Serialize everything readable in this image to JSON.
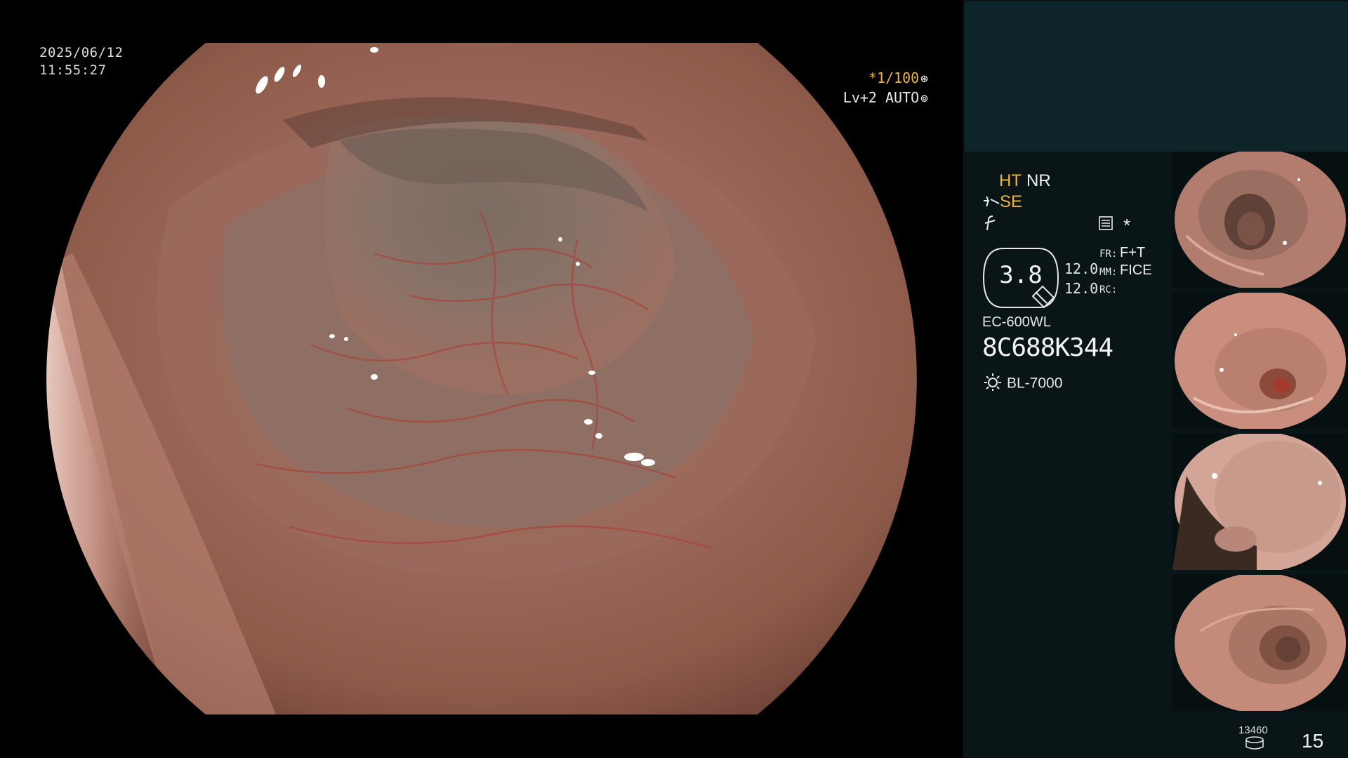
{
  "osd": {
    "date": "2025/06/12",
    "time": "11:55:27",
    "shutter": "*1/100",
    "shutter_icon": "aperture-icon",
    "level": "Lv+2 AUTO",
    "level_icon": "iris-icon"
  },
  "status": {
    "ht": "HT",
    "nr": "NR",
    "se": "SE",
    "se_icon": "enhance-icon",
    "filter_icon": "filter-icon",
    "menu_icon": "settings-list-icon",
    "asterisk": "*"
  },
  "zoom": {
    "value": "3.8",
    "num1": "12.0",
    "num2": "12.0"
  },
  "modes": {
    "fr_key": "FR:",
    "fr_val": "F+T",
    "mm_key": "MM:",
    "mm_val": "FICE",
    "rc_key": "RC:",
    "rc_val": ""
  },
  "scope": {
    "model": "EC-600WL",
    "serial": "8C688K344",
    "light_source": "BL-7000",
    "light_icon": "light-source-icon"
  },
  "counter": {
    "label": "13460",
    "icon": "storage-icon",
    "value": "15"
  },
  "colors": {
    "accent_orange": "#f0b23a",
    "panel_bg": "#091516",
    "panel_top": "#0d2528",
    "tissue": "#a9705f"
  },
  "thumbnails": [
    {
      "name": "capture-1"
    },
    {
      "name": "capture-2"
    },
    {
      "name": "capture-3"
    },
    {
      "name": "capture-4"
    }
  ]
}
